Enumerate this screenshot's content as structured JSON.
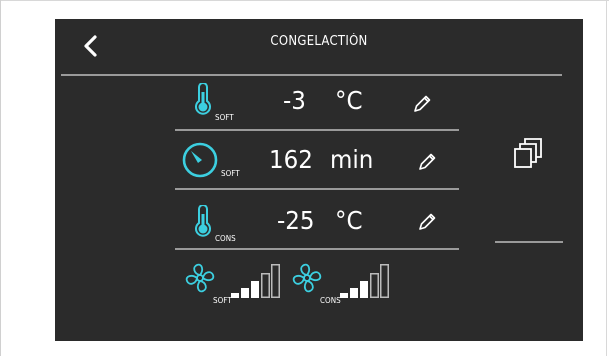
{
  "header": {
    "title": "CONGELACTIÓN",
    "back_icon": "chevron-left-icon"
  },
  "colors": {
    "accent": "#3ccfe0",
    "background": "#2b2b2b",
    "divider": "#9a9a9a"
  },
  "rows": [
    {
      "icon": "thermometer-icon",
      "sub": "SOFT",
      "value": "-3",
      "unit": "°C"
    },
    {
      "icon": "timer-icon",
      "sub": "SOFT",
      "value": "162",
      "unit": "min"
    },
    {
      "icon": "thermometer-icon",
      "sub": "CONS",
      "value": "-25",
      "unit": "°C"
    }
  ],
  "fans": [
    {
      "icon": "fan-icon",
      "sub": "SOFT",
      "level": 3,
      "max_level": 5
    },
    {
      "icon": "fan-icon",
      "sub": "CONS",
      "level": 3,
      "max_level": 5
    }
  ],
  "side": {
    "copy_icon": "copy-icon"
  }
}
